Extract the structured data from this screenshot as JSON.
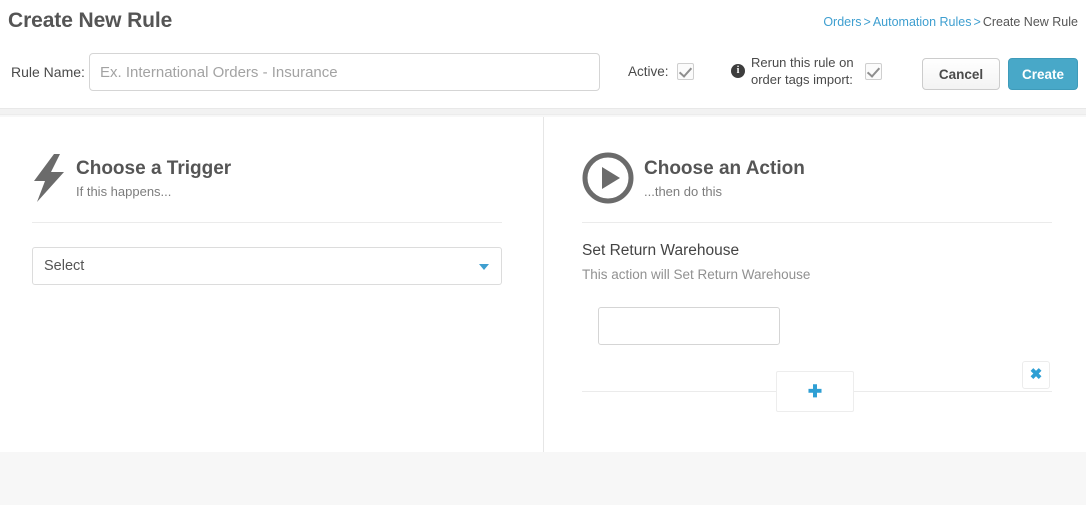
{
  "header": {
    "title": "Create New Rule",
    "breadcrumb": {
      "items": [
        "Orders",
        "Automation Rules"
      ],
      "separator": ">",
      "current": "Create New Rule"
    },
    "rule_name_label": "Rule Name:",
    "rule_name_value": "",
    "rule_name_placeholder": "Ex. International Orders - Insurance",
    "active_label": "Active:",
    "active_checked": true,
    "rerun_label": "Rerun this rule on order tags import:",
    "rerun_checked": true,
    "info_icon_glyph": "i",
    "cancel_label": "Cancel",
    "create_label": "Create"
  },
  "trigger_panel": {
    "icon": "lightning-bolt-icon",
    "title": "Choose a Trigger",
    "subtitle": "If this happens...",
    "select_value": "Select"
  },
  "action_panel": {
    "icon": "play-circle-icon",
    "title": "Choose an Action",
    "subtitle": "...then do this",
    "action": {
      "name": "Set Return Warehouse",
      "description": "This action will Set Return Warehouse",
      "value": "",
      "remove_glyph": "✖"
    },
    "add_glyph": "✚"
  },
  "colors": {
    "accent_blue": "#3f9fd0",
    "create_button": "#48a8c8",
    "icon_gray": "#6b6b6b",
    "page_background": "#f7f7f7",
    "card_background": "#ffffff"
  }
}
